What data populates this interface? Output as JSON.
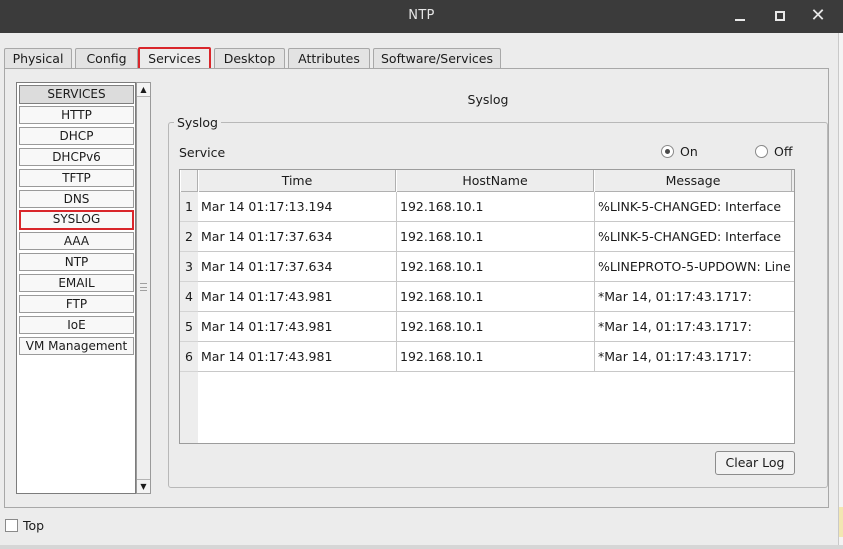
{
  "window": {
    "title": "NTP",
    "minimize_icon": "minimize-icon",
    "maximize_icon": "maximize-icon",
    "close_icon": "close-icon",
    "close_glyph": "✕"
  },
  "tabs": [
    {
      "label": "Physical",
      "active": false
    },
    {
      "label": "Config",
      "active": false
    },
    {
      "label": "Services",
      "active": true
    },
    {
      "label": "Desktop",
      "active": false
    },
    {
      "label": "Attributes",
      "active": false
    },
    {
      "label": "Software/Services",
      "active": false
    }
  ],
  "services": {
    "header": "SERVICES",
    "items": [
      "HTTP",
      "DHCP",
      "DHCPv6",
      "TFTP",
      "DNS",
      "SYSLOG",
      "AAA",
      "NTP",
      "EMAIL",
      "FTP",
      "IoE",
      "VM Management"
    ],
    "selected": "SYSLOG",
    "scroll_up_glyph": "▲",
    "scroll_down_glyph": "▼"
  },
  "syslog": {
    "heading": "Syslog",
    "group_title": "Syslog",
    "service_label": "Service",
    "on_label": "On",
    "off_label": "Off",
    "on_selected": true,
    "columns": [
      "Time",
      "HostName",
      "Message"
    ],
    "rows": [
      {
        "num": "1",
        "time": "Mar 14 01:17:13.194",
        "host": "192.168.10.1",
        "message": "%LINK-5-CHANGED: Interface"
      },
      {
        "num": "2",
        "time": "Mar 14 01:17:37.634",
        "host": "192.168.10.1",
        "message": "%LINK-5-CHANGED: Interface"
      },
      {
        "num": "3",
        "time": "Mar 14 01:17:37.634",
        "host": "192.168.10.1",
        "message": "%LINEPROTO-5-UPDOWN: Line"
      },
      {
        "num": "4",
        "time": "Mar 14 01:17:43.981",
        "host": "192.168.10.1",
        "message": "*Mar 14, 01:17:43.1717:"
      },
      {
        "num": "5",
        "time": "Mar 14 01:17:43.981",
        "host": "192.168.10.1",
        "message": "*Mar 14, 01:17:43.1717:"
      },
      {
        "num": "6",
        "time": "Mar 14 01:17:43.981",
        "host": "192.168.10.1",
        "message": "*Mar 14, 01:17:43.1717:"
      }
    ],
    "clear_button": "Clear Log"
  },
  "footer": {
    "top_label": "Top",
    "top_checked": false
  },
  "colors": {
    "titlebar": "#3b3b3b",
    "highlight": "#d9262b",
    "background": "#ececec"
  }
}
